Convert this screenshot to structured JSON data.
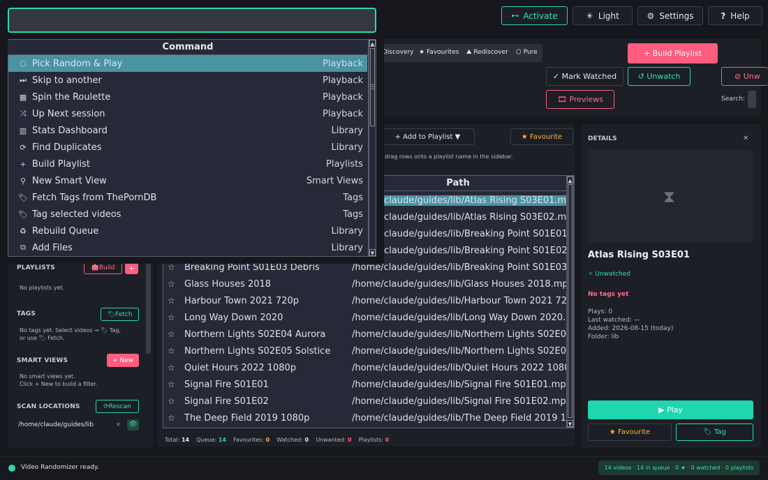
{
  "topbar": {
    "activate": "Activate",
    "light": "Light",
    "settings": "Settings",
    "help": "Help"
  },
  "filters": [
    "Discovery",
    "Favourites",
    "Rediscover",
    "Pure"
  ],
  "actions": {
    "build_playlist": "+ Build Playlist",
    "mark_watched": "✓ Mark Watched",
    "unwatch": "↺ Unwatch",
    "unwatch2": "⊘ Unw",
    "previews": "🎞 Previews",
    "search_label": "Search:"
  },
  "toolbar2": {
    "add_to_playlist": "+ Add to Playlist ▼",
    "favourite": "★ Favourite",
    "hint": "drag rows onto a playlist name in the sidebar."
  },
  "palette": {
    "header": "Command",
    "items": [
      {
        "icon": "⬡",
        "name": "Pick Random & Play",
        "cat": "Playback"
      },
      {
        "icon": "⏭",
        "name": "Skip to another",
        "cat": "Playback"
      },
      {
        "icon": "▦",
        "name": "Spin the Roulette",
        "cat": "Playback"
      },
      {
        "icon": "⤨",
        "name": "Up Next session",
        "cat": "Playback"
      },
      {
        "icon": "▥",
        "name": "Stats Dashboard",
        "cat": "Library"
      },
      {
        "icon": "⟳",
        "name": "Find Duplicates",
        "cat": "Library"
      },
      {
        "icon": "+",
        "name": "Build Playlist",
        "cat": "Playlists"
      },
      {
        "icon": "⚲",
        "name": "New Smart View",
        "cat": "Smart Views"
      },
      {
        "icon": "🏷",
        "name": "Fetch Tags from ThePornDB",
        "cat": "Tags"
      },
      {
        "icon": "🏷",
        "name": "Tag selected videos",
        "cat": "Tags"
      },
      {
        "icon": "♻",
        "name": "Rebuild Queue",
        "cat": "Library"
      },
      {
        "icon": "⧉",
        "name": "Add Files",
        "cat": "Library"
      }
    ]
  },
  "table": {
    "path_header": "Path",
    "top_paths": [
      "claude/guides/lib/Atlas Rising S03E01.mp4",
      "claude/guides/lib/Atlas Rising S03E02.mp4",
      "claude/guides/lib/Breaking Point S01E01 P",
      "claude/guides/lib/Breaking Point S01E02 F"
    ],
    "rows": [
      {
        "name": "Breaking Point S01E03 Debris",
        "path": "/home/claude/guides/lib/Breaking Point S01E03 D"
      },
      {
        "name": "Glass Houses 2018",
        "path": "/home/claude/guides/lib/Glass Houses 2018.mp4"
      },
      {
        "name": "Harbour Town 2021 720p",
        "path": "/home/claude/guides/lib/Harbour Town 2021 720p"
      },
      {
        "name": "Long Way Down 2020",
        "path": "/home/claude/guides/lib/Long Way Down 2020.mp"
      },
      {
        "name": "Northern Lights S02E04 Aurora",
        "path": "/home/claude/guides/lib/Northern Lights S02E04 A"
      },
      {
        "name": "Northern Lights S02E05 Solstice",
        "path": "/home/claude/guides/lib/Northern Lights S02E05 S"
      },
      {
        "name": "Quiet Hours 2022 1080p",
        "path": "/home/claude/guides/lib/Quiet Hours 2022 1080p."
      },
      {
        "name": "Signal Fire S01E01",
        "path": "/home/claude/guides/lib/Signal Fire S01E01.mp4"
      },
      {
        "name": "Signal Fire S01E02",
        "path": "/home/claude/guides/lib/Signal Fire S01E02.mp4"
      },
      {
        "name": "The Deep Field 2019 1080p",
        "path": "/home/claude/guides/lib/The Deep Field 2019 108"
      }
    ]
  },
  "sidebar": {
    "playlists": "PLAYLISTS",
    "build": "Build",
    "plus": "+",
    "no_playlists": "No playlists yet.",
    "tags": "TAGS",
    "fetch": "Fetch",
    "no_tags_1": "No tags yet. Select videos → 🏷 Tag,",
    "no_tags_2": "or use 🏷 Fetch.",
    "smart_views": "SMART VIEWS",
    "new": "+ New",
    "no_smart_1": "No smart views yet.",
    "no_smart_2": "Click + New to build a filter.",
    "scan_locations": "SCAN LOCATIONS",
    "rescan": "Rescan",
    "scan_path": "/home/claude/guides/lib",
    "remove": "✕"
  },
  "stats": {
    "total_label": "Total:",
    "total": "14",
    "queue_label": "Queue:",
    "queue": "14",
    "fav_label": "Favourites:",
    "fav": "0",
    "watched_label": "Watched:",
    "watched": "0",
    "unwanted_label": "Unwanted:",
    "unwanted": "0",
    "playlists_label": "Playlists:",
    "playlists": "0"
  },
  "details": {
    "header": "DETAILS",
    "close": "✕",
    "title": "Atlas Rising S03E01",
    "status": "✧ Unwatched",
    "no_tags": "No tags yet",
    "plays": "Plays:  0",
    "last_watched": "Last watched:  —",
    "added": "Added:  2026-08-15  (today)",
    "folder": "Folder:  lib",
    "play": "▶ Play",
    "favourite": "★ Favourite",
    "tag": "🏷 Tag"
  },
  "statusbar": {
    "message": "Video Randomizer ready.",
    "summary": "14 videos · 14 in queue · 0 ★ · 0 watched · 0 playlists"
  }
}
